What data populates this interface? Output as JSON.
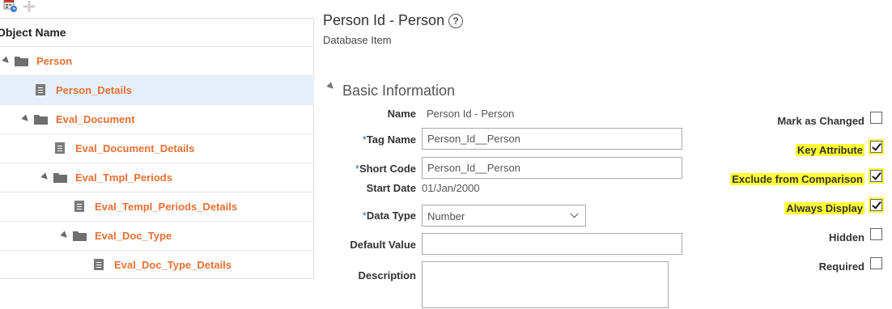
{
  "tree": {
    "header": "Object Name",
    "rows": [
      {
        "label": "Person"
      },
      {
        "label": "Person_Details"
      },
      {
        "label": "Eval_Document"
      },
      {
        "label": "Eval_Document_Details"
      },
      {
        "label": "Eval_Tmpl_Periods"
      },
      {
        "label": "Eval_Templ_Periods_Details"
      },
      {
        "label": "Eval_Doc_Type"
      },
      {
        "label": "Eval_Doc_Type_Details"
      }
    ]
  },
  "header": {
    "title": "Person Id - Person",
    "help": "?",
    "subtitle": "Database Item"
  },
  "section": {
    "title": "Basic Information"
  },
  "form": {
    "name_label": "Name",
    "name_value": "Person Id - Person",
    "required_mark": "*",
    "tag_name_label": "Tag Name",
    "tag_name_value": "Person_Id__Person",
    "short_code_label": "Short Code",
    "short_code_value": "Person_Id__Person",
    "start_date_label": "Start Date",
    "start_date_value": "01/Jan/2000",
    "data_type_label": "Data Type",
    "data_type_value": "Number",
    "default_value_label": "Default Value",
    "default_value_value": "",
    "description_label": "Description",
    "description_value": ""
  },
  "flags": {
    "mark_as_changed": {
      "label": "Mark as Changed",
      "checked": false
    },
    "key_attribute": {
      "label": "Key Attribute",
      "checked": true
    },
    "exclude_from_comparison": {
      "label": "Exclude from Comparison",
      "checked": true
    },
    "always_display": {
      "label": "Always Display",
      "checked": true
    },
    "hidden": {
      "label": "Hidden",
      "checked": false
    },
    "required": {
      "label": "Required",
      "checked": false
    }
  },
  "colors": {
    "tree_link": "#e87033",
    "selected_row": "#e6f0fa",
    "highlight": "#ffff33"
  }
}
